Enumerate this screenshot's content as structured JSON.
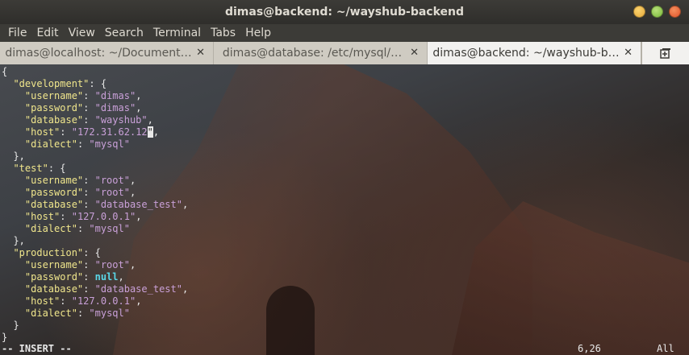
{
  "window": {
    "title": "dimas@backend: ~/wayshub-backend"
  },
  "menu": [
    "File",
    "Edit",
    "View",
    "Search",
    "Terminal",
    "Tabs",
    "Help"
  ],
  "tabs": [
    {
      "label": "dimas@localhost: ~/Document…",
      "close": "✕"
    },
    {
      "label": "dimas@database: /etc/mysql/…",
      "close": "✕"
    },
    {
      "label": "dimas@backend: ~/wayshub-b…",
      "close": "✕"
    }
  ],
  "code_lines": [
    [
      {
        "t": "{",
        "c": "p"
      }
    ],
    [
      {
        "t": "  ",
        "c": "p"
      },
      {
        "t": "\"development\"",
        "c": "k"
      },
      {
        "t": ": {",
        "c": "p"
      }
    ],
    [
      {
        "t": "    ",
        "c": "p"
      },
      {
        "t": "\"username\"",
        "c": "k"
      },
      {
        "t": ": ",
        "c": "p"
      },
      {
        "t": "\"dimas\"",
        "c": "s"
      },
      {
        "t": ",",
        "c": "p"
      }
    ],
    [
      {
        "t": "    ",
        "c": "p"
      },
      {
        "t": "\"password\"",
        "c": "k"
      },
      {
        "t": ": ",
        "c": "p"
      },
      {
        "t": "\"dimas\"",
        "c": "s"
      },
      {
        "t": ",",
        "c": "p"
      }
    ],
    [
      {
        "t": "    ",
        "c": "p"
      },
      {
        "t": "\"database\"",
        "c": "k"
      },
      {
        "t": ": ",
        "c": "p"
      },
      {
        "t": "\"wayshub\"",
        "c": "s"
      },
      {
        "t": ",",
        "c": "p"
      }
    ],
    [
      {
        "t": "    ",
        "c": "p"
      },
      {
        "t": "\"host\"",
        "c": "k"
      },
      {
        "t": ": ",
        "c": "p"
      },
      {
        "t": "\"172.31.62.12",
        "c": "s"
      },
      {
        "t": "\"",
        "c": "cursor"
      },
      {
        "t": ",",
        "c": "p"
      }
    ],
    [
      {
        "t": "    ",
        "c": "p"
      },
      {
        "t": "\"dialect\"",
        "c": "k"
      },
      {
        "t": ": ",
        "c": "p"
      },
      {
        "t": "\"mysql\"",
        "c": "s"
      }
    ],
    [
      {
        "t": "  },",
        "c": "p"
      }
    ],
    [
      {
        "t": "  ",
        "c": "p"
      },
      {
        "t": "\"test\"",
        "c": "k"
      },
      {
        "t": ": {",
        "c": "p"
      }
    ],
    [
      {
        "t": "    ",
        "c": "p"
      },
      {
        "t": "\"username\"",
        "c": "k"
      },
      {
        "t": ": ",
        "c": "p"
      },
      {
        "t": "\"root\"",
        "c": "s"
      },
      {
        "t": ",",
        "c": "p"
      }
    ],
    [
      {
        "t": "    ",
        "c": "p"
      },
      {
        "t": "\"password\"",
        "c": "k"
      },
      {
        "t": ": ",
        "c": "p"
      },
      {
        "t": "\"root\"",
        "c": "s"
      },
      {
        "t": ",",
        "c": "p"
      }
    ],
    [
      {
        "t": "    ",
        "c": "p"
      },
      {
        "t": "\"database\"",
        "c": "k"
      },
      {
        "t": ": ",
        "c": "p"
      },
      {
        "t": "\"database_test\"",
        "c": "s"
      },
      {
        "t": ",",
        "c": "p"
      }
    ],
    [
      {
        "t": "    ",
        "c": "p"
      },
      {
        "t": "\"host\"",
        "c": "k"
      },
      {
        "t": ": ",
        "c": "p"
      },
      {
        "t": "\"127.0.0.1\"",
        "c": "s"
      },
      {
        "t": ",",
        "c": "p"
      }
    ],
    [
      {
        "t": "    ",
        "c": "p"
      },
      {
        "t": "\"dialect\"",
        "c": "k"
      },
      {
        "t": ": ",
        "c": "p"
      },
      {
        "t": "\"mysql\"",
        "c": "s"
      }
    ],
    [
      {
        "t": "  },",
        "c": "p"
      }
    ],
    [
      {
        "t": "  ",
        "c": "p"
      },
      {
        "t": "\"production\"",
        "c": "k"
      },
      {
        "t": ": {",
        "c": "p"
      }
    ],
    [
      {
        "t": "    ",
        "c": "p"
      },
      {
        "t": "\"username\"",
        "c": "k"
      },
      {
        "t": ": ",
        "c": "p"
      },
      {
        "t": "\"root\"",
        "c": "s"
      },
      {
        "t": ",",
        "c": "p"
      }
    ],
    [
      {
        "t": "    ",
        "c": "p"
      },
      {
        "t": "\"password\"",
        "c": "k"
      },
      {
        "t": ": ",
        "c": "p"
      },
      {
        "t": "null",
        "c": "n"
      },
      {
        "t": ",",
        "c": "p"
      }
    ],
    [
      {
        "t": "    ",
        "c": "p"
      },
      {
        "t": "\"database\"",
        "c": "k"
      },
      {
        "t": ": ",
        "c": "p"
      },
      {
        "t": "\"database_test\"",
        "c": "s"
      },
      {
        "t": ",",
        "c": "p"
      }
    ],
    [
      {
        "t": "    ",
        "c": "p"
      },
      {
        "t": "\"host\"",
        "c": "k"
      },
      {
        "t": ": ",
        "c": "p"
      },
      {
        "t": "\"127.0.0.1\"",
        "c": "s"
      },
      {
        "t": ",",
        "c": "p"
      }
    ],
    [
      {
        "t": "    ",
        "c": "p"
      },
      {
        "t": "\"dialect\"",
        "c": "k"
      },
      {
        "t": ": ",
        "c": "p"
      },
      {
        "t": "\"mysql\"",
        "c": "s"
      }
    ],
    [
      {
        "t": "  }",
        "c": "p"
      }
    ],
    [
      {
        "t": "}",
        "c": "p"
      }
    ]
  ],
  "status": {
    "mode": "-- INSERT --",
    "position": "6,26",
    "scroll": "All"
  },
  "colors": {
    "key": "#f0e68c",
    "string": "#c9a0d8",
    "null": "#5ad7e8"
  },
  "icons": {
    "new_tab": "new-tab-icon"
  }
}
